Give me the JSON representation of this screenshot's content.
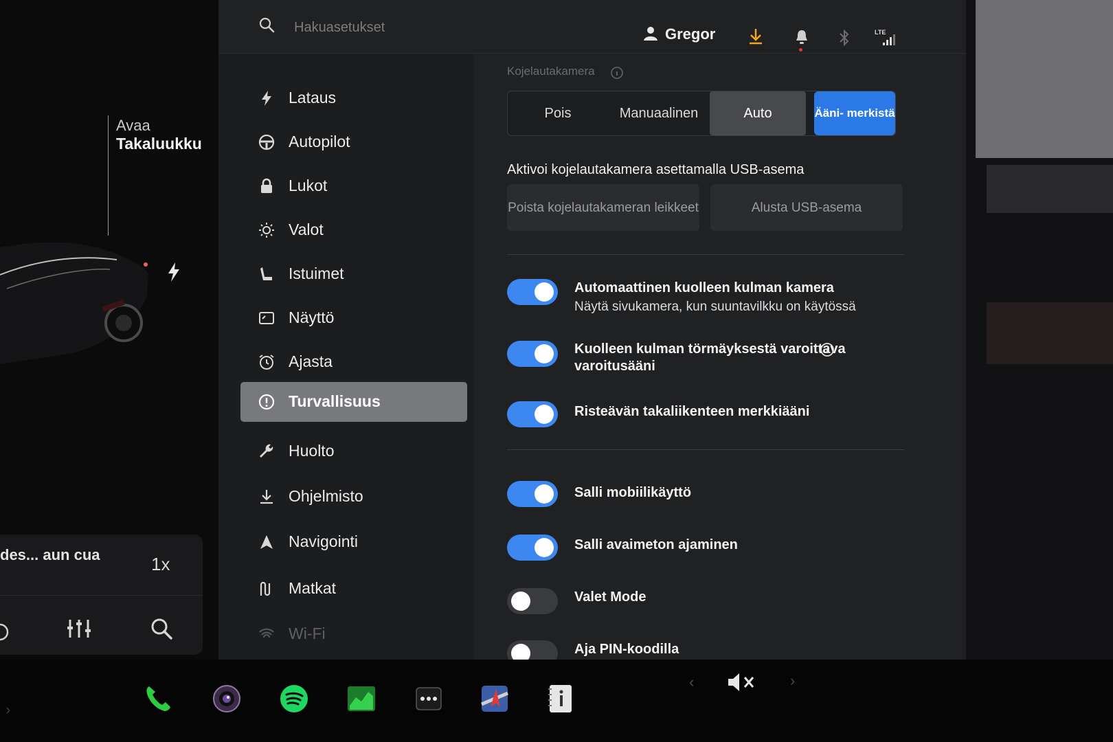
{
  "car": {
    "trunk_action": "Avaa",
    "trunk_label": "Takaluukku",
    "charge_icon": "lightning-icon"
  },
  "media": {
    "title": "des... aun cua",
    "speed": "1x",
    "icons": [
      "prev-icon",
      "equalizer-icon",
      "search-icon"
    ]
  },
  "header": {
    "search_placeholder": "Hakuasetukset",
    "user_name": "Gregor",
    "network_label": "LTE",
    "icons": [
      "user-icon",
      "download-icon",
      "bell-icon",
      "bluetooth-icon",
      "signal-icon"
    ],
    "accent": "#f5a623"
  },
  "sidebar": {
    "items": [
      {
        "label": "Lataus",
        "icon": "lightning-icon"
      },
      {
        "label": "Autopilot",
        "icon": "steering-wheel-icon"
      },
      {
        "label": "Lukot",
        "icon": "lock-icon"
      },
      {
        "label": "Valot",
        "icon": "sun-icon"
      },
      {
        "label": "Istuimet",
        "icon": "seat-icon"
      },
      {
        "label": "Näyttö",
        "icon": "display-icon"
      },
      {
        "label": "Ajasta",
        "icon": "alarm-clock-icon"
      },
      {
        "label": "Turvallisuus",
        "icon": "alert-circle-icon",
        "active": true
      },
      {
        "label": "Huolto",
        "icon": "wrench-icon"
      },
      {
        "label": "Ohjelmisto",
        "icon": "download-icon"
      },
      {
        "label": "Navigointi",
        "icon": "navigation-icon"
      },
      {
        "label": "Matkat",
        "icon": "route-icon"
      },
      {
        "label": "Wi-Fi",
        "icon": "wifi-icon"
      }
    ]
  },
  "dashcam": {
    "label": "Kojelautakamera",
    "options": [
      "Pois",
      "Manuaalinen",
      "Auto",
      "Ääni- merkistä"
    ],
    "selected": "Auto",
    "usb_title": "Aktivoi kojelautakamera asettamalla USB-asema",
    "delete_clips": "Poista kojelautakameran leikkeet",
    "format_usb": "Alusta USB-asema"
  },
  "toggles": [
    {
      "title": "Automaattinen kuolleen kulman kamera",
      "subtitle": "Näytä sivukamera, kun suuntavilkku on käytössä",
      "on": true
    },
    {
      "title": "Kuolleen kulman törmäyksestä varoittava varoitusääni",
      "on": true
    },
    {
      "title": "Risteävän takaliikenteen merkkiääni",
      "on": true
    },
    {
      "title": "Salli mobiilikäyttö",
      "on": true
    },
    {
      "title": "Salli avaimeton ajaminen",
      "on": true
    },
    {
      "title": "Valet Mode",
      "on": false
    },
    {
      "title": "Aja PIN-koodilla",
      "on": false
    }
  ],
  "taskbar": {
    "apps": [
      "phone-icon",
      "camera-icon",
      "spotify-icon",
      "stocks-icon",
      "more-icon",
      "navigation-app-icon",
      "manual-icon"
    ],
    "volume_icon": "mute-icon",
    "colors": {
      "phone": "#2ecc40",
      "spotify": "#1ed760",
      "toggle_on": "#3d87f0"
    }
  }
}
